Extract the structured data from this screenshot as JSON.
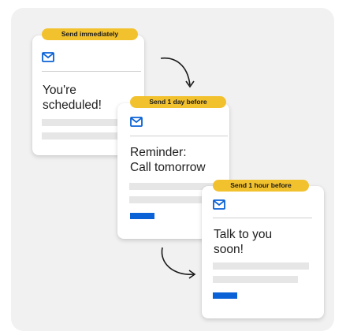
{
  "colors": {
    "badge": "#f2c12e",
    "accent": "#0b62d6",
    "panel": "#f1f1f1",
    "placeholder": "#e6e6e6",
    "text": "#1e1e1e"
  },
  "cards": [
    {
      "badge": "Send immediately",
      "message": "You're\nscheduled!",
      "icon": "mail-icon"
    },
    {
      "badge": "Send 1 day before",
      "message": "Reminder:\nCall tomorrow",
      "icon": "mail-icon"
    },
    {
      "badge": "Send 1 hour before",
      "message": "Talk to you\nsoon!",
      "icon": "mail-icon"
    }
  ]
}
